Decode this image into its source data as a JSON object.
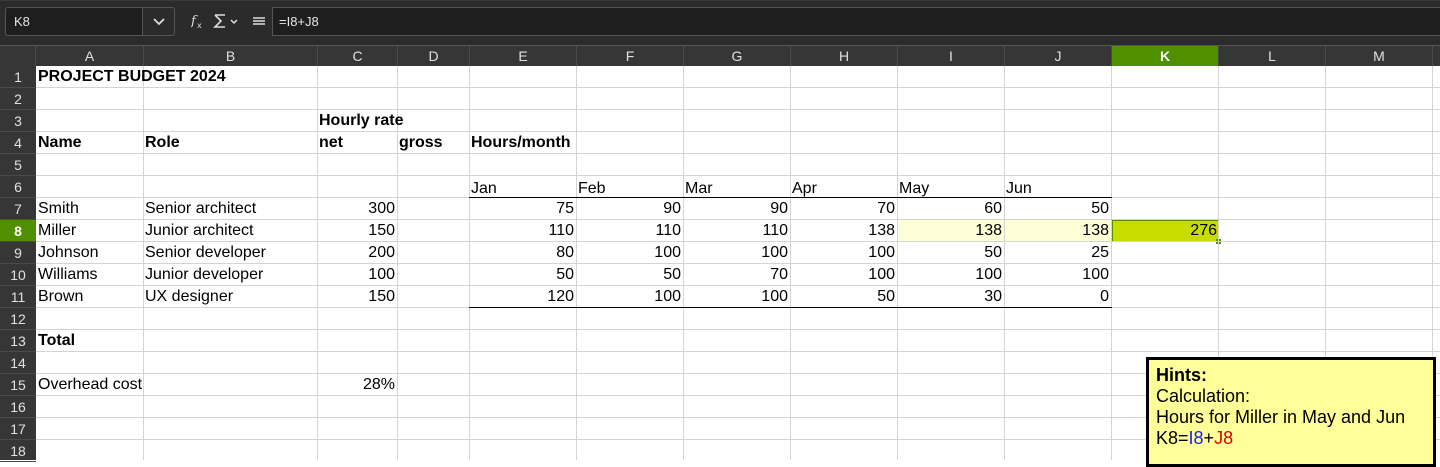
{
  "formula_bar": {
    "name_box": "K8",
    "formula": "=I8+J8",
    "icons": [
      "chevron-down-icon",
      "function-wizard-icon",
      "sum-icon",
      "formula-icon"
    ]
  },
  "columns": [
    "A",
    "B",
    "C",
    "D",
    "E",
    "F",
    "G",
    "H",
    "I",
    "J",
    "K",
    "L",
    "M"
  ],
  "selected_column": "K",
  "rows": [
    "1",
    "2",
    "3",
    "4",
    "5",
    "6",
    "7",
    "8",
    "9",
    "10",
    "11",
    "12",
    "13",
    "14",
    "15",
    "16",
    "17",
    "18"
  ],
  "selected_row": "8",
  "sheet": {
    "title": "PROJECT BUDGET 2024",
    "hourly_rate": "Hourly rate",
    "headers": {
      "name": "Name",
      "role": "Role",
      "net": "net",
      "gross": "gross",
      "hours_month": "Hours/month"
    },
    "months": [
      "Jan",
      "Feb",
      "Mar",
      "Apr",
      "May",
      "Jun"
    ],
    "people": [
      {
        "name": "Smith",
        "role": "Senior architect",
        "rate": "300",
        "hours": [
          "75",
          "90",
          "90",
          "70",
          "60",
          "50"
        ]
      },
      {
        "name": "Miller",
        "role": "Junior architect",
        "rate": "150",
        "hours": [
          "110",
          "110",
          "110",
          "138",
          "138",
          "138"
        ]
      },
      {
        "name": "Johnson",
        "role": "Senior developer",
        "rate": "200",
        "hours": [
          "80",
          "100",
          "100",
          "100",
          "50",
          "25"
        ]
      },
      {
        "name": "Williams",
        "role": "Junior developer",
        "rate": "100",
        "hours": [
          "50",
          "50",
          "70",
          "100",
          "100",
          "100"
        ]
      },
      {
        "name": "Brown",
        "role": "UX designer",
        "rate": "150",
        "hours": [
          "120",
          "100",
          "100",
          "50",
          "30",
          "0"
        ]
      }
    ],
    "total_label": "Total",
    "overhead_label": "Overhead cost",
    "overhead_value": "28%",
    "active_cell_value": "276"
  },
  "note": {
    "title": "Hints:",
    "line1": "Calculation:",
    "line2": "Hours for Miller in May and Jun",
    "formula_prefix": "K8=",
    "ref1": "I8",
    "plus": "+",
    "ref2": "J8"
  },
  "colors": {
    "selection_header": "#4f8f00",
    "active_cell": "#c8dc00",
    "highlight_range": "#ffffd7",
    "note_bg": "#ffff99",
    "ref1_color": "#1a1aff",
    "ref2_color": "#e00000"
  }
}
